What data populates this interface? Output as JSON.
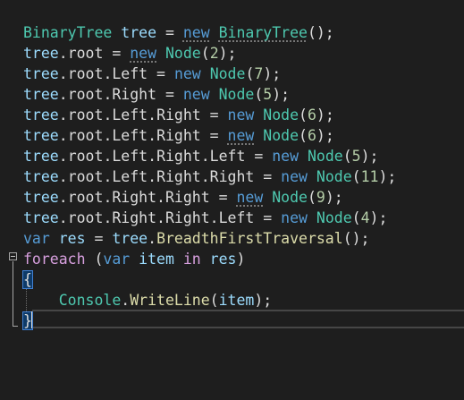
{
  "editor": {
    "lines": [
      [
        {
          "text": "BinaryTree",
          "cls": "t-type"
        },
        {
          "text": " ",
          "cls": "t-plain"
        },
        {
          "text": "tree",
          "cls": "t-var"
        },
        {
          "text": " = ",
          "cls": "t-plain"
        },
        {
          "text": "new",
          "cls": "t-kw hint"
        },
        {
          "text": " ",
          "cls": "t-plain"
        },
        {
          "text": "BinaryTree",
          "cls": "t-type hint"
        },
        {
          "text": "();",
          "cls": "t-punc"
        }
      ],
      [
        {
          "text": "tree",
          "cls": "t-var"
        },
        {
          "text": ".",
          "cls": "t-punc"
        },
        {
          "text": "root",
          "cls": "t-prop"
        },
        {
          "text": " = ",
          "cls": "t-plain"
        },
        {
          "text": "new",
          "cls": "t-kw hint"
        },
        {
          "text": " ",
          "cls": "t-plain"
        },
        {
          "text": "Node",
          "cls": "t-type"
        },
        {
          "text": "(",
          "cls": "t-punc"
        },
        {
          "text": "2",
          "cls": "t-num"
        },
        {
          "text": ");",
          "cls": "t-punc"
        }
      ],
      [
        {
          "text": "tree",
          "cls": "t-var"
        },
        {
          "text": ".",
          "cls": "t-punc"
        },
        {
          "text": "root",
          "cls": "t-prop"
        },
        {
          "text": ".",
          "cls": "t-punc"
        },
        {
          "text": "Left",
          "cls": "t-prop"
        },
        {
          "text": " = ",
          "cls": "t-plain"
        },
        {
          "text": "new",
          "cls": "t-kw"
        },
        {
          "text": " ",
          "cls": "t-plain"
        },
        {
          "text": "Node",
          "cls": "t-type"
        },
        {
          "text": "(",
          "cls": "t-punc"
        },
        {
          "text": "7",
          "cls": "t-num"
        },
        {
          "text": ");",
          "cls": "t-punc"
        }
      ],
      [
        {
          "text": "tree",
          "cls": "t-var"
        },
        {
          "text": ".",
          "cls": "t-punc"
        },
        {
          "text": "root",
          "cls": "t-prop"
        },
        {
          "text": ".",
          "cls": "t-punc"
        },
        {
          "text": "Right",
          "cls": "t-prop"
        },
        {
          "text": " = ",
          "cls": "t-plain"
        },
        {
          "text": "new",
          "cls": "t-kw"
        },
        {
          "text": " ",
          "cls": "t-plain"
        },
        {
          "text": "Node",
          "cls": "t-type"
        },
        {
          "text": "(",
          "cls": "t-punc"
        },
        {
          "text": "5",
          "cls": "t-num"
        },
        {
          "text": ");",
          "cls": "t-punc"
        }
      ],
      [
        {
          "text": "tree",
          "cls": "t-var"
        },
        {
          "text": ".",
          "cls": "t-punc"
        },
        {
          "text": "root",
          "cls": "t-prop"
        },
        {
          "text": ".",
          "cls": "t-punc"
        },
        {
          "text": "Left",
          "cls": "t-prop"
        },
        {
          "text": ".",
          "cls": "t-punc"
        },
        {
          "text": "Right",
          "cls": "t-prop"
        },
        {
          "text": " = ",
          "cls": "t-plain"
        },
        {
          "text": "new",
          "cls": "t-kw"
        },
        {
          "text": " ",
          "cls": "t-plain"
        },
        {
          "text": "Node",
          "cls": "t-type"
        },
        {
          "text": "(",
          "cls": "t-punc"
        },
        {
          "text": "6",
          "cls": "t-num"
        },
        {
          "text": ");",
          "cls": "t-punc"
        }
      ],
      [
        {
          "text": "tree",
          "cls": "t-var"
        },
        {
          "text": ".",
          "cls": "t-punc"
        },
        {
          "text": "root",
          "cls": "t-prop"
        },
        {
          "text": ".",
          "cls": "t-punc"
        },
        {
          "text": "Left",
          "cls": "t-prop"
        },
        {
          "text": ".",
          "cls": "t-punc"
        },
        {
          "text": "Right",
          "cls": "t-prop"
        },
        {
          "text": " = ",
          "cls": "t-plain"
        },
        {
          "text": "new",
          "cls": "t-kw hint"
        },
        {
          "text": " ",
          "cls": "t-plain"
        },
        {
          "text": "Node",
          "cls": "t-type"
        },
        {
          "text": "(",
          "cls": "t-punc"
        },
        {
          "text": "6",
          "cls": "t-num"
        },
        {
          "text": ");",
          "cls": "t-punc"
        }
      ],
      [
        {
          "text": "tree",
          "cls": "t-var"
        },
        {
          "text": ".",
          "cls": "t-punc"
        },
        {
          "text": "root",
          "cls": "t-prop"
        },
        {
          "text": ".",
          "cls": "t-punc"
        },
        {
          "text": "Left",
          "cls": "t-prop"
        },
        {
          "text": ".",
          "cls": "t-punc"
        },
        {
          "text": "Right",
          "cls": "t-prop"
        },
        {
          "text": ".",
          "cls": "t-punc"
        },
        {
          "text": "Left",
          "cls": "t-prop"
        },
        {
          "text": " = ",
          "cls": "t-plain"
        },
        {
          "text": "new",
          "cls": "t-kw"
        },
        {
          "text": " ",
          "cls": "t-plain"
        },
        {
          "text": "Node",
          "cls": "t-type"
        },
        {
          "text": "(",
          "cls": "t-punc"
        },
        {
          "text": "5",
          "cls": "t-num"
        },
        {
          "text": ");",
          "cls": "t-punc"
        }
      ],
      [
        {
          "text": "tree",
          "cls": "t-var"
        },
        {
          "text": ".",
          "cls": "t-punc"
        },
        {
          "text": "root",
          "cls": "t-prop"
        },
        {
          "text": ".",
          "cls": "t-punc"
        },
        {
          "text": "Left",
          "cls": "t-prop"
        },
        {
          "text": ".",
          "cls": "t-punc"
        },
        {
          "text": "Right",
          "cls": "t-prop"
        },
        {
          "text": ".",
          "cls": "t-punc"
        },
        {
          "text": "Right",
          "cls": "t-prop"
        },
        {
          "text": " = ",
          "cls": "t-plain"
        },
        {
          "text": "new",
          "cls": "t-kw"
        },
        {
          "text": " ",
          "cls": "t-plain"
        },
        {
          "text": "Node",
          "cls": "t-type"
        },
        {
          "text": "(",
          "cls": "t-punc"
        },
        {
          "text": "11",
          "cls": "t-num"
        },
        {
          "text": ");",
          "cls": "t-punc"
        }
      ],
      [
        {
          "text": "tree",
          "cls": "t-var"
        },
        {
          "text": ".",
          "cls": "t-punc"
        },
        {
          "text": "root",
          "cls": "t-prop"
        },
        {
          "text": ".",
          "cls": "t-punc"
        },
        {
          "text": "Right",
          "cls": "t-prop"
        },
        {
          "text": ".",
          "cls": "t-punc"
        },
        {
          "text": "Right",
          "cls": "t-prop"
        },
        {
          "text": " = ",
          "cls": "t-plain"
        },
        {
          "text": "new",
          "cls": "t-kw hint"
        },
        {
          "text": " ",
          "cls": "t-plain"
        },
        {
          "text": "Node",
          "cls": "t-type"
        },
        {
          "text": "(",
          "cls": "t-punc"
        },
        {
          "text": "9",
          "cls": "t-num"
        },
        {
          "text": ");",
          "cls": "t-punc"
        }
      ],
      [
        {
          "text": "tree",
          "cls": "t-var"
        },
        {
          "text": ".",
          "cls": "t-punc"
        },
        {
          "text": "root",
          "cls": "t-prop"
        },
        {
          "text": ".",
          "cls": "t-punc"
        },
        {
          "text": "Right",
          "cls": "t-prop"
        },
        {
          "text": ".",
          "cls": "t-punc"
        },
        {
          "text": "Right",
          "cls": "t-prop"
        },
        {
          "text": ".",
          "cls": "t-punc"
        },
        {
          "text": "Left",
          "cls": "t-prop"
        },
        {
          "text": " = ",
          "cls": "t-plain"
        },
        {
          "text": "new",
          "cls": "t-kw"
        },
        {
          "text": " ",
          "cls": "t-plain"
        },
        {
          "text": "Node",
          "cls": "t-type"
        },
        {
          "text": "(",
          "cls": "t-punc"
        },
        {
          "text": "4",
          "cls": "t-num"
        },
        {
          "text": ");",
          "cls": "t-punc"
        }
      ],
      [
        {
          "text": "var",
          "cls": "t-kw"
        },
        {
          "text": " ",
          "cls": "t-plain"
        },
        {
          "text": "res",
          "cls": "t-var"
        },
        {
          "text": " = ",
          "cls": "t-plain"
        },
        {
          "text": "tree",
          "cls": "t-var"
        },
        {
          "text": ".",
          "cls": "t-punc"
        },
        {
          "text": "BreadthFirstTraversal",
          "cls": "t-method"
        },
        {
          "text": "();",
          "cls": "t-punc"
        }
      ],
      [
        {
          "text": "foreach",
          "cls": "t-ctl"
        },
        {
          "text": " (",
          "cls": "t-punc"
        },
        {
          "text": "var",
          "cls": "t-kw"
        },
        {
          "text": " ",
          "cls": "t-plain"
        },
        {
          "text": "item",
          "cls": "t-var"
        },
        {
          "text": " ",
          "cls": "t-plain"
        },
        {
          "text": "in",
          "cls": "t-ctl"
        },
        {
          "text": " ",
          "cls": "t-plain"
        },
        {
          "text": "res",
          "cls": "t-var"
        },
        {
          "text": ")",
          "cls": "t-punc"
        }
      ],
      [
        {
          "text": "{",
          "cls": "t-punc brace-box"
        }
      ],
      [
        {
          "text": "    ",
          "cls": "t-plain"
        },
        {
          "text": "Console",
          "cls": "t-type"
        },
        {
          "text": ".",
          "cls": "t-punc"
        },
        {
          "text": "WriteLine",
          "cls": "t-method"
        },
        {
          "text": "(",
          "cls": "t-punc"
        },
        {
          "text": "item",
          "cls": "t-var"
        },
        {
          "text": ");",
          "cls": "t-punc"
        }
      ],
      [
        {
          "text": "}",
          "cls": "t-punc brace-box"
        }
      ]
    ]
  }
}
